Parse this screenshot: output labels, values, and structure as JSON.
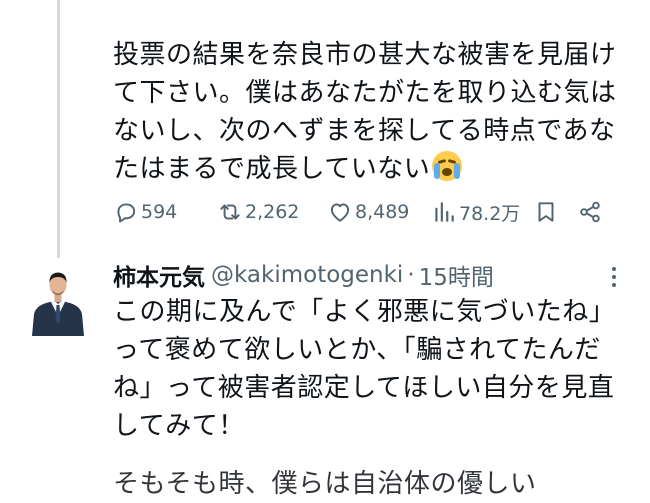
{
  "post": {
    "text": "投票の結果を奈良市の甚大な被害を見届けて下さい。僕はあなたがたを取り込む気はないし、次のへずまを探してる時点であなたはまるで成長していない",
    "emoji": "loudly-crying-face",
    "actions": {
      "replies": "594",
      "reposts": "2,262",
      "likes": "8,489",
      "views": "78.2万"
    }
  },
  "reply": {
    "name": "柿本元気",
    "handle": "@kakimotogenki",
    "dot": "·",
    "time": "15時間",
    "text": "この期に及んで「よく邪悪に気づいたね」って褒めて欲しいとか、「騙されてたんだね」って被害者認定してほしい自分を見直してみて！",
    "next_line_partial": "そもそも時、僕らは自治体の優しい"
  },
  "colors": {
    "text": "#0f1419",
    "secondary": "#536471",
    "thread_line": "#cfd9de"
  },
  "icons": [
    "reply-icon",
    "repost-icon",
    "like-icon",
    "views-icon",
    "bookmark-icon",
    "share-icon",
    "more-icon"
  ]
}
